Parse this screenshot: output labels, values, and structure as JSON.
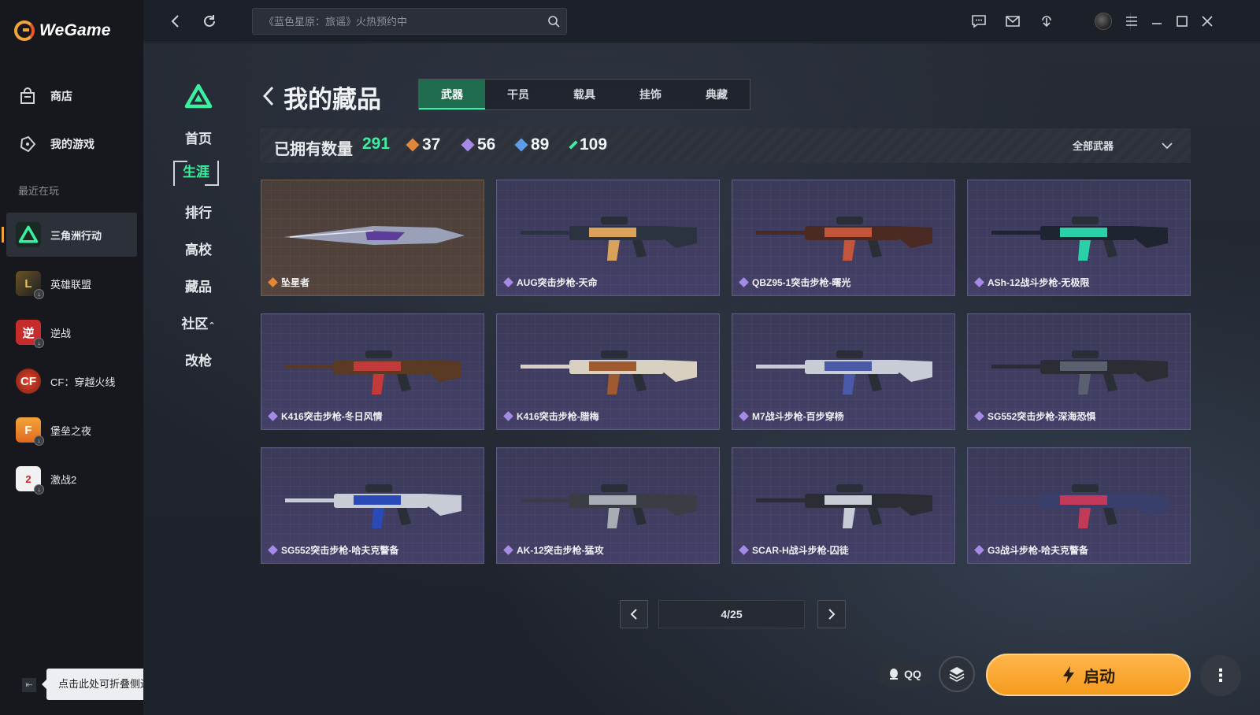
{
  "app": {
    "name": "WeGame",
    "brand_color": "#f2a43b",
    "accent_color": "#3bf0a0"
  },
  "sidebar": {
    "nav": [
      {
        "label": "商店",
        "icon": "store-bag-icon"
      },
      {
        "label": "我的游戏",
        "icon": "gamepad-icon"
      }
    ],
    "recent_label": "最近在玩",
    "games": [
      {
        "label": "三角洲行动",
        "icon": "delta-force-icon",
        "active": true
      },
      {
        "label": "英雄联盟",
        "icon": "league-of-legends-icon"
      },
      {
        "label": "逆战",
        "icon": "nizhan-icon"
      },
      {
        "label": "CF：穿越火线",
        "icon": "crossfire-icon"
      },
      {
        "label": "堡垒之夜",
        "icon": "fortnite-icon"
      },
      {
        "label": "激战2",
        "icon": "guild-wars-2-icon"
      }
    ],
    "collapse_tooltip": "点击此处可折叠侧边栏"
  },
  "topbar": {
    "search_placeholder": "《蓝色星原：旅谣》火热预约中"
  },
  "game_nav": {
    "items": [
      "首页",
      "生涯",
      "排行",
      "高校",
      "藏品",
      "社区",
      "改枪"
    ],
    "active": "生涯"
  },
  "collection": {
    "title": "我的藏品",
    "tabs": [
      "武器",
      "干员",
      "载具",
      "挂饰",
      "典藏"
    ],
    "active_tab": "武器",
    "owned_label": "已拥有数量",
    "owned_total": "291",
    "rarity_counts": [
      {
        "value": "37",
        "color": "#e0873a"
      },
      {
        "value": "56",
        "color": "#a58be6"
      },
      {
        "value": "89",
        "color": "#5c9de8"
      },
      {
        "value": "109",
        "color": "#3bf0a0"
      }
    ],
    "filter_label": "全部武器",
    "items": [
      {
        "name": "坠星者",
        "rarity": "orange"
      },
      {
        "name": "AUG突击步枪-天命",
        "rarity": "purple"
      },
      {
        "name": "QBZ95-1突击步枪-曙光",
        "rarity": "purple"
      },
      {
        "name": "ASh-12战斗步枪-无极限",
        "rarity": "purple"
      },
      {
        "name": "K416突击步枪-冬日风情",
        "rarity": "purple"
      },
      {
        "name": "K416突击步枪-腊梅",
        "rarity": "purple"
      },
      {
        "name": "M7战斗步枪-百步穿杨",
        "rarity": "purple"
      },
      {
        "name": "SG552突击步枪-深海恐惧",
        "rarity": "purple"
      },
      {
        "name": "SG552突击步枪-哈夫克警备",
        "rarity": "purple"
      },
      {
        "name": "AK-12突击步枪-猛攻",
        "rarity": "purple"
      },
      {
        "name": "SCAR-H战斗步枪-囚徒",
        "rarity": "purple"
      },
      {
        "name": "G3战斗步枪-哈夫克警备",
        "rarity": "purple"
      }
    ],
    "pagination": "4/25"
  },
  "launcher": {
    "qq_label": "QQ",
    "launch_label": "启动",
    "launch_color": "#f59a1e"
  }
}
